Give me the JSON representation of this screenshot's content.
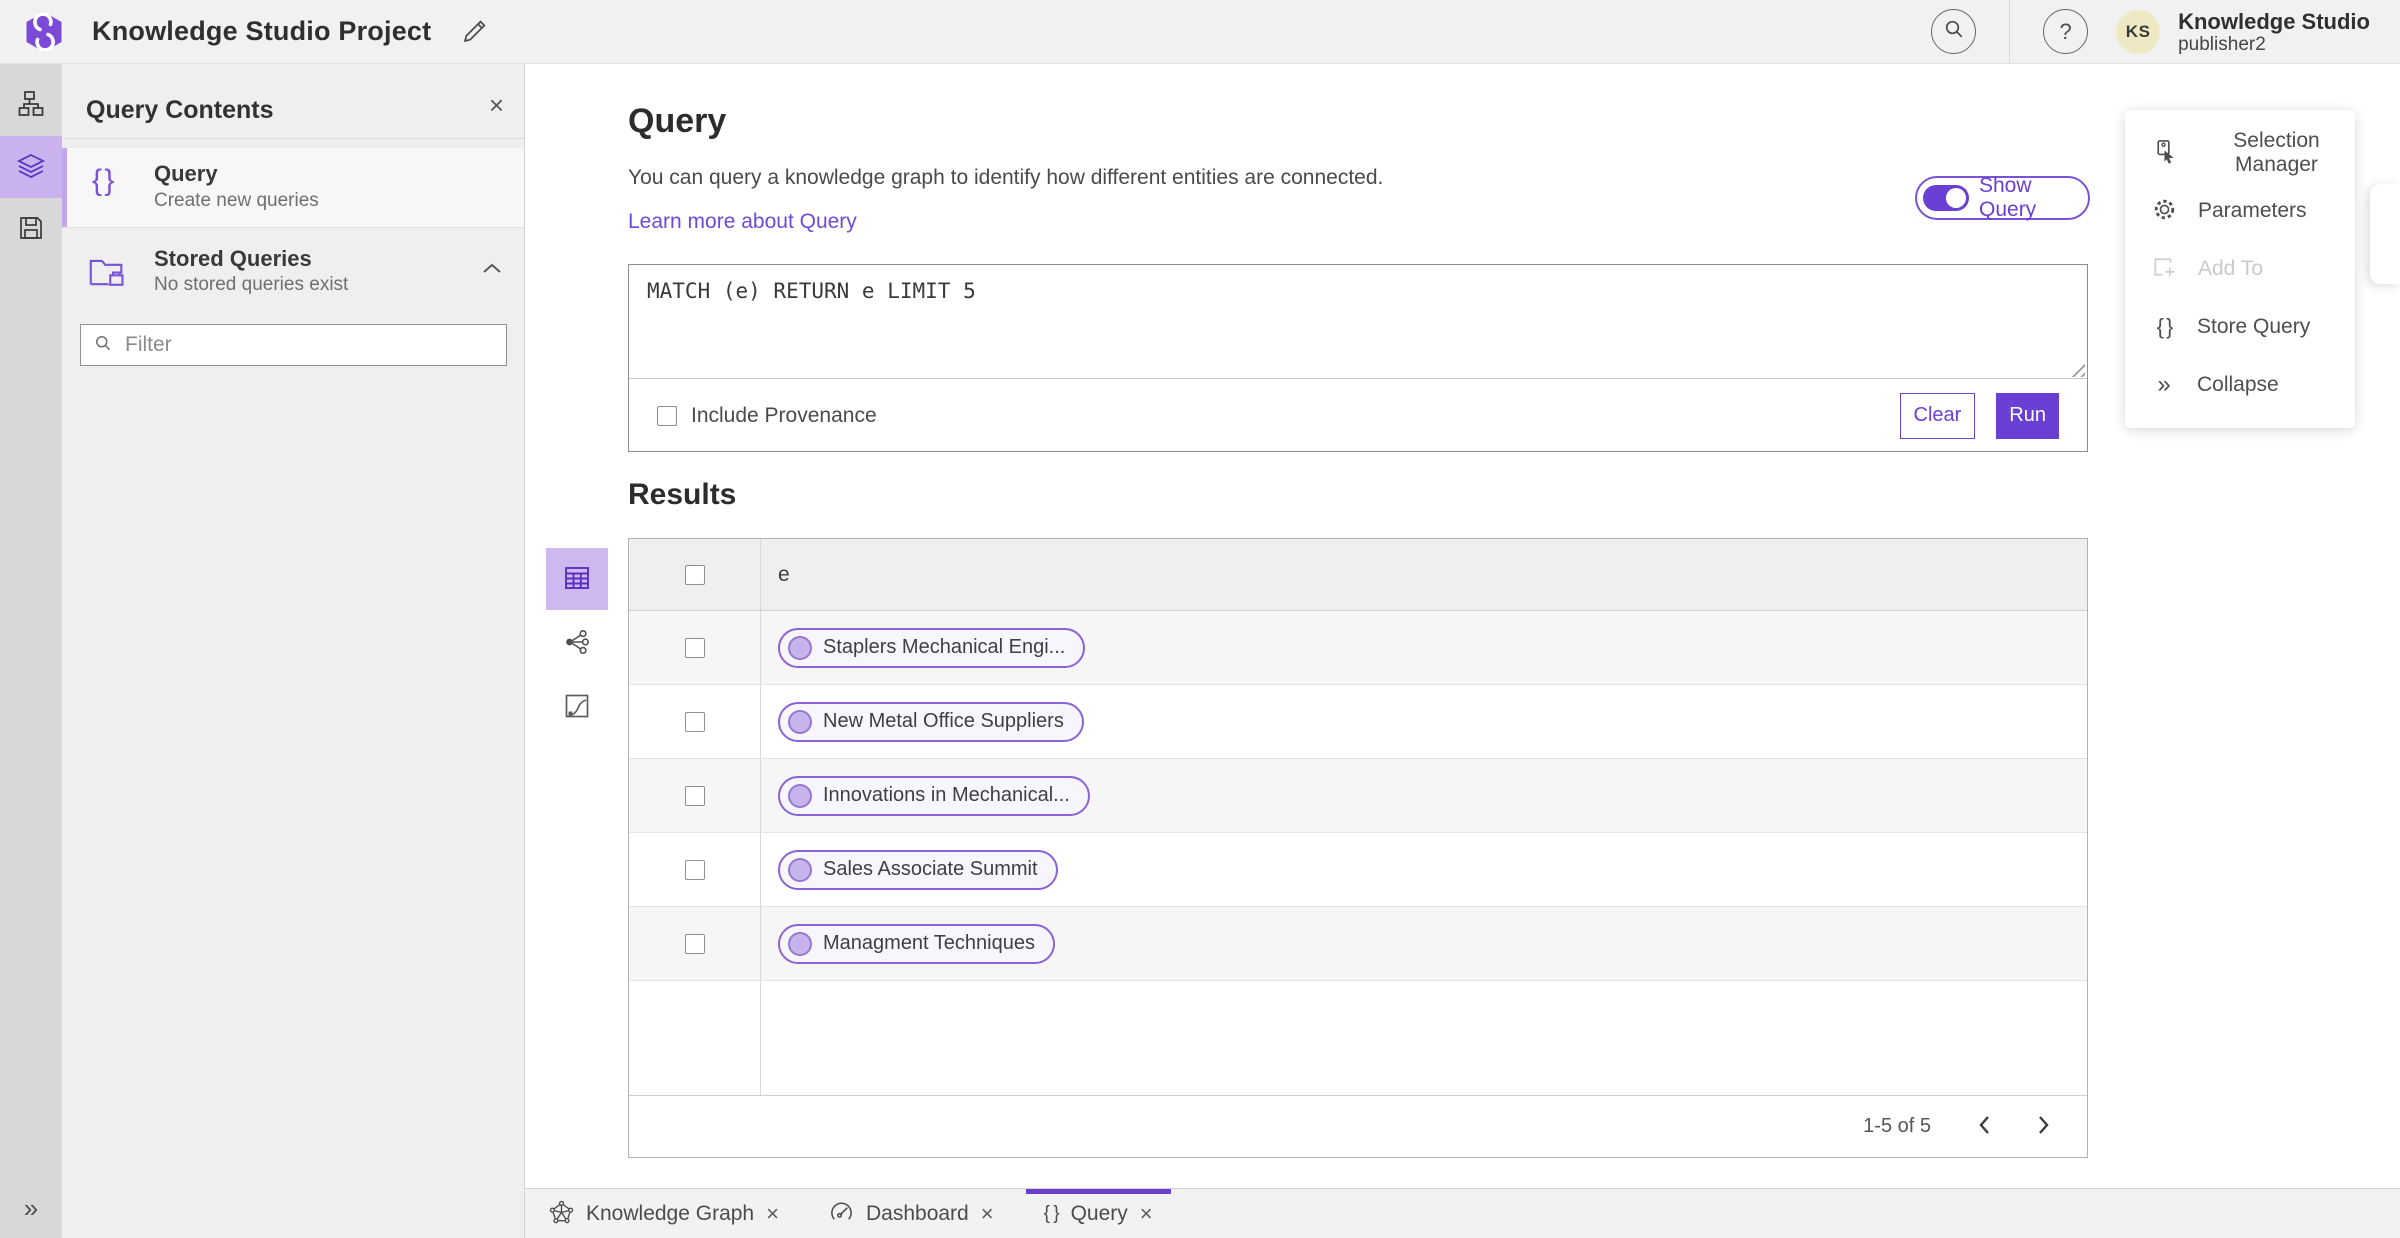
{
  "header": {
    "title": "Knowledge Studio Project",
    "user_name": "Knowledge Studio",
    "user_role": "publisher2",
    "avatar_initials": "KS"
  },
  "icons": {
    "close": "×",
    "help": "?",
    "braces": "{ }",
    "chevrons_right": "»"
  },
  "query_contents": {
    "title": "Query Contents",
    "query_item": {
      "label": "Query",
      "description": "Create new queries"
    },
    "stored_item": {
      "label": "Stored Queries",
      "description": "No stored queries exist"
    },
    "filter_placeholder": "Filter"
  },
  "query_panel": {
    "title": "Query",
    "description": "You can query a knowledge graph to identify how different entities are connected.",
    "learn_more": "Learn more about Query",
    "show_query_label": "Show Query",
    "query_text": "MATCH (e) RETURN e LIMIT 5",
    "include_provenance_label": "Include Provenance",
    "clear_label": "Clear",
    "run_label": "Run"
  },
  "results": {
    "title": "Results",
    "column_header": "e",
    "rows": [
      {
        "label": "Staplers Mechanical Engi..."
      },
      {
        "label": "New Metal Office Suppliers"
      },
      {
        "label": "Innovations in Mechanical..."
      },
      {
        "label": "Sales Associate Summit"
      },
      {
        "label": "Managment Techniques"
      }
    ],
    "pagination": {
      "range_text": "1-5 of 5"
    }
  },
  "actions_menu": {
    "items": [
      {
        "label": "Selection Manager",
        "disabled": false
      },
      {
        "label": "Parameters",
        "disabled": false
      },
      {
        "label": "Add To",
        "disabled": true
      },
      {
        "label": "Store Query",
        "disabled": false
      },
      {
        "label": "Collapse",
        "disabled": false
      }
    ]
  },
  "bottom_tabs": [
    {
      "label": "Knowledge Graph",
      "active": false
    },
    {
      "label": "Dashboard",
      "active": false
    },
    {
      "label": "Query",
      "active": true
    }
  ],
  "colors": {
    "accent_purple": "#6a3fd4",
    "icon_purple": "#7a52d8",
    "active_highlight": "#c9b2ee",
    "pill_border": "#8a63d6",
    "pill_circle_fill": "#c7b4ec",
    "avatar_bg": "#efe9c3",
    "header_bg": "#f1f1f1",
    "rail_bg": "#d8d8d8",
    "panel_bg": "#efefef"
  }
}
